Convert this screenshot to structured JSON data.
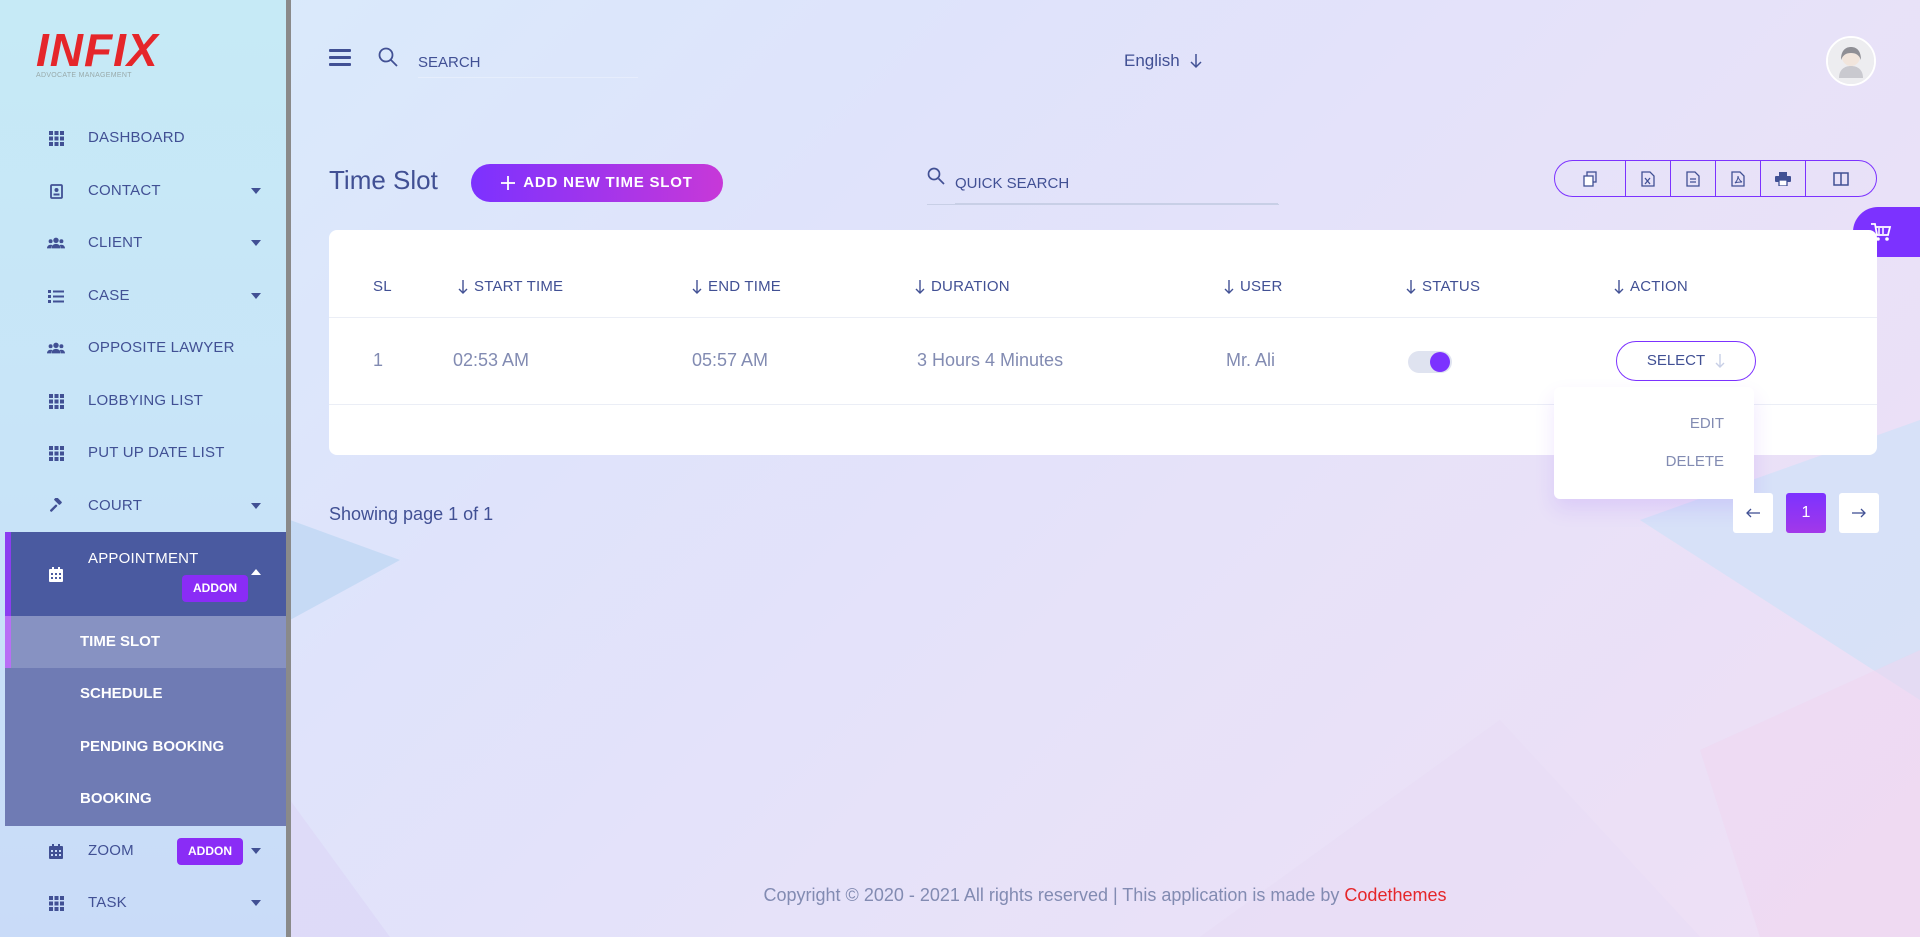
{
  "logo": {
    "main": "INFIX",
    "sub": "ADVOCATE MANAGEMENT"
  },
  "sidebar": {
    "items": [
      {
        "label": "DASHBOARD",
        "icon": "grid-icon"
      },
      {
        "label": "CONTACT",
        "icon": "contact-card-icon",
        "has_caret": true
      },
      {
        "label": "CLIENT",
        "icon": "users-icon",
        "has_caret": true
      },
      {
        "label": "CASE",
        "icon": "list-icon",
        "has_caret": true
      },
      {
        "label": "OPPOSITE LAWYER",
        "icon": "users-icon"
      },
      {
        "label": "LOBBYING LIST",
        "icon": "grid-icon"
      },
      {
        "label": "PUT UP DATE LIST",
        "icon": "grid-icon"
      },
      {
        "label": "COURT",
        "icon": "gavel-icon",
        "has_caret": true
      },
      {
        "label": "APPOINTMENT",
        "icon": "calendar-icon",
        "badge": "ADDON",
        "expanded": true
      },
      {
        "label": "ZOOM",
        "icon": "calendar-icon",
        "badge": "ADDON",
        "has_caret": true
      },
      {
        "label": "TASK",
        "icon": "grid-icon",
        "has_caret": true
      }
    ],
    "appointment_submenu": [
      "TIME SLOT",
      "SCHEDULE",
      "PENDING BOOKING",
      "BOOKING"
    ],
    "active_sub": "TIME SLOT"
  },
  "header": {
    "search_placeholder": "SEARCH",
    "language": "English"
  },
  "main": {
    "title": "Time Slot",
    "add_button": "ADD NEW TIME SLOT",
    "quick_search_placeholder": "QUICK SEARCH",
    "export_buttons": [
      "copy-icon",
      "excel-icon",
      "csv-icon",
      "pdf-icon",
      "print-icon",
      "columns-icon"
    ],
    "table": {
      "columns": [
        "SL",
        "START TIME",
        "END TIME",
        "DURATION",
        "USER",
        "STATUS",
        "ACTION"
      ],
      "rows": [
        {
          "sl": "1",
          "start": "02:53 AM",
          "end": "05:57 AM",
          "duration": "3 Hours 4 Minutes",
          "user": "Mr. Ali",
          "status_on": true,
          "action": "SELECT"
        }
      ]
    },
    "action_menu": [
      "EDIT",
      "DELETE"
    ],
    "pagination": {
      "info": "Showing page 1 of 1",
      "current": "1"
    }
  },
  "footer": {
    "text": "Copyright © 2020 - 2021 All rights reserved | This application is made by ",
    "link": "Codethemes"
  },
  "colors": {
    "primary": "#7c32ff",
    "accent": "#c738d8",
    "text": "#415094",
    "muted": "#828bb2",
    "brand_red": "#e5262a"
  }
}
